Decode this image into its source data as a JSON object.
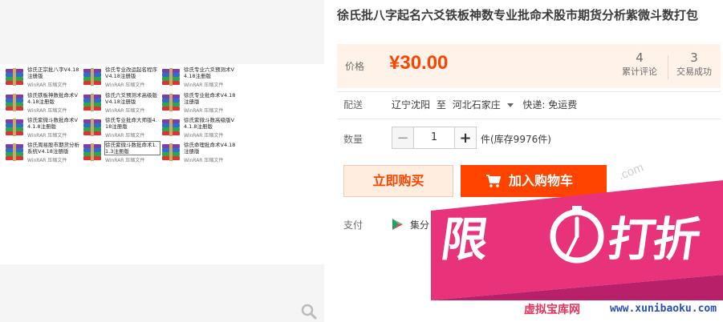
{
  "product": {
    "title": "徐氏批八字起名六爻铁板神数专业批命术股市期货分析紫微斗数打包"
  },
  "price": {
    "label": "价格",
    "value": "¥30.00"
  },
  "stats": [
    {
      "num": "4",
      "label": "累计评论"
    },
    {
      "num": "3",
      "label": "交易成功"
    }
  ],
  "shipping": {
    "label": "配送",
    "from": "辽宁沈阳",
    "to_word": "至",
    "to": "河北石家庄",
    "fee": "快递: 免运费"
  },
  "quantity": {
    "label": "数量",
    "minus": "−",
    "plus": "+",
    "value": "1",
    "stock": "件(库存9976件)"
  },
  "actions": {
    "buy_now": "立即购买",
    "add_to_cart": "加入购物车"
  },
  "payment": {
    "label": "支付",
    "method": "集分"
  },
  "gallery": {
    "files": [
      {
        "name": "徐氏正宗批八字V4.18注册版",
        "type": "WinRAR 压缩文件"
      },
      {
        "name": "徐氏专业改运起名程序V4.18注册版",
        "type": "WinRAR 压缩文件"
      },
      {
        "name": "徐氏专业六爻预测术V4.18注册版",
        "type": "WinRAR 压缩文件"
      },
      {
        "name": "徐氏铁板神数批命术V4.18注册版",
        "type": "WinRAR 压缩文件"
      },
      {
        "name": "徐氏六爻预测术高级版V4.18注册版",
        "type": "WinRAR 压缩文件"
      },
      {
        "name": "徐氏专业批命术V4.18注册版",
        "type": "WinRAR 压缩文件"
      },
      {
        "name": "徐氏紫微斗数批命术V4.1.8注册版",
        "type": "WinRAR 压缩文件"
      },
      {
        "name": "徐氏专业批命大师版4.18注册版",
        "type": "WinRAR 压缩文件"
      },
      {
        "name": "徐氏紫微斗数高级版V4.1.8注册版",
        "type": "WinRAR 压缩文件"
      },
      {
        "name": "徐氏周易股市期货分析系统V4.18注册版",
        "type": "WinRAR 压缩文件"
      },
      {
        "name": "徐氏紫微斗数批命术1.1.3注册版",
        "type": "WinRAR 压缩文件"
      },
      {
        "name": "徐氏命理批命术V4.18注册版",
        "type": "WinRAR 压缩文件"
      }
    ]
  },
  "promo": {
    "char1": "限",
    "char2": "打折"
  },
  "watermarks": {
    "corner": ".com",
    "site_name": "虚拟宝库网",
    "site_url": "www.xunibaoku.com"
  },
  "colors": {
    "accent": "#ff4400",
    "promo_pink": "#e8337a"
  }
}
